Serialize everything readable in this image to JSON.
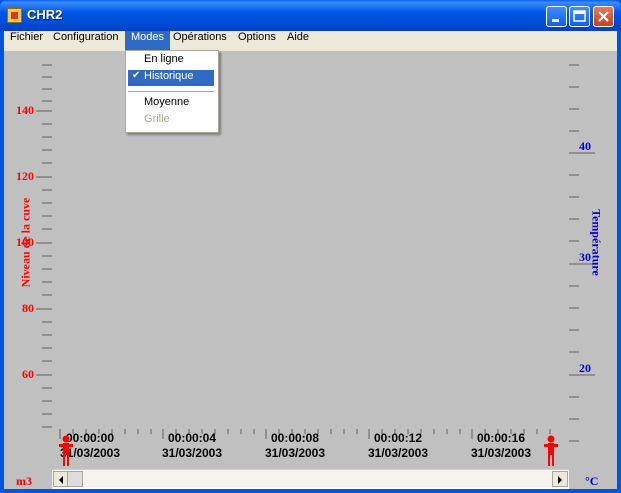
{
  "window": {
    "title": "CHR2"
  },
  "menubar": {
    "items": [
      "Fichier",
      "Configuration",
      "Modes",
      "Opérations",
      "Options",
      "Aide"
    ]
  },
  "modes_menu": {
    "items": [
      {
        "label": "En ligne",
        "checked": false,
        "enabled": true
      },
      {
        "label": "Historique",
        "checked": true,
        "enabled": true
      },
      {
        "label": "Moyenne",
        "checked": false,
        "enabled": true
      },
      {
        "label": "Grille",
        "checked": false,
        "enabled": false
      }
    ]
  },
  "left_axis": {
    "title": "Niveau de la cuve",
    "unit": "m3",
    "ticks": [
      "140",
      "120",
      "100",
      "80",
      "60"
    ],
    "color": "#ff0000"
  },
  "right_axis": {
    "title": "Température",
    "unit": "°C",
    "ticks": [
      "40",
      "30",
      "20"
    ],
    "color": "#0000cc"
  },
  "time_axis": {
    "labels": [
      {
        "time": "00:00:00",
        "date": "31/03/2003"
      },
      {
        "time": "00:00:04",
        "date": "31/03/2003"
      },
      {
        "time": "00:00:08",
        "date": "31/03/2003"
      },
      {
        "time": "00:00:12",
        "date": "31/03/2003"
      },
      {
        "time": "00:00:16",
        "date": "31/03/2003"
      }
    ]
  },
  "icons": {
    "app": "app-icon",
    "minimize": "minimize-icon",
    "maximize": "maximize-icon",
    "close": "close-icon",
    "marker": "person-marker-icon"
  }
}
